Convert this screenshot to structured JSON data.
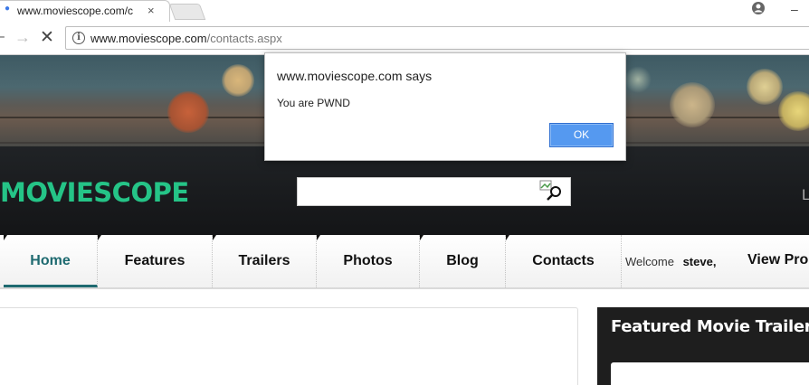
{
  "browser": {
    "tab": {
      "title": "www.moviescope.com/contacts.aspx",
      "close_glyph": "×"
    },
    "address_bar": {
      "domain": "www.moviescope.com",
      "path": "/contacts.aspx"
    },
    "icons": {
      "back": "arrow-left-icon",
      "forward": "arrow-right-icon",
      "stop": "close-icon",
      "info": "info-icon",
      "profile": "account-icon"
    }
  },
  "site": {
    "logo": "MOVIESCOPE",
    "search": {
      "value": "",
      "placeholder": ""
    },
    "nav": {
      "items": [
        {
          "label": "Home",
          "active": true
        },
        {
          "label": "Features"
        },
        {
          "label": "Trailers"
        },
        {
          "label": "Photos"
        },
        {
          "label": "Blog"
        },
        {
          "label": "Contacts"
        }
      ],
      "welcome_prefix": "Welcome",
      "username": "steve,",
      "view_profile": "View Pro"
    },
    "sidebar": {
      "featured_title": "Featured Movie Trailers"
    },
    "colors": {
      "logo": "#25c487",
      "nav_active": "#1e6a70",
      "ok_button": "#5599f0"
    }
  },
  "dialog": {
    "origin": "www.moviescope.com says",
    "message": "You are PWND",
    "ok_label": "OK"
  }
}
